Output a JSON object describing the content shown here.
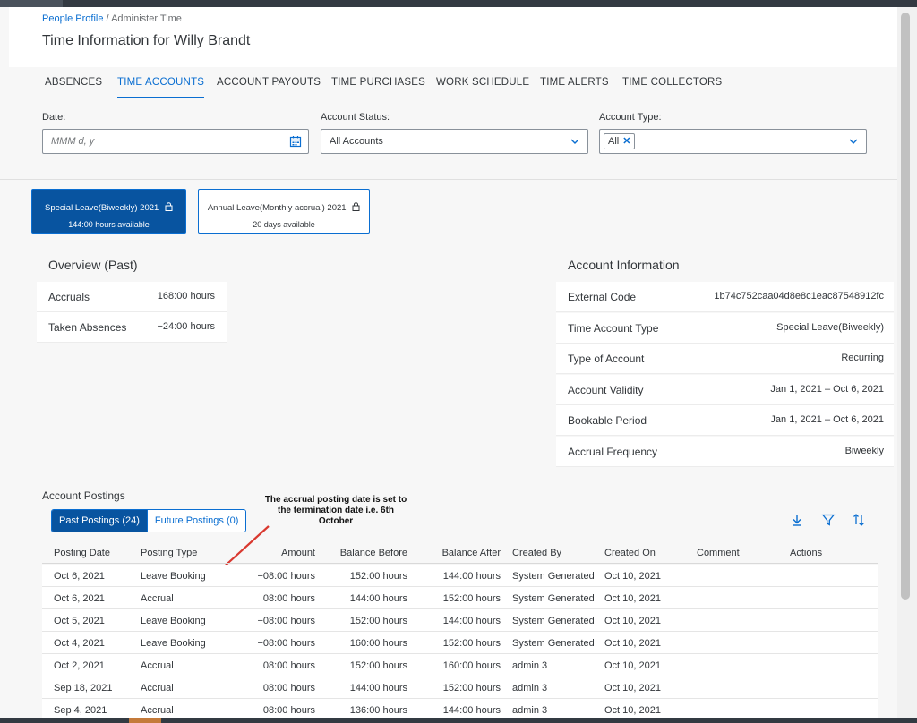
{
  "breadcrumb": {
    "link": "People Profile",
    "separator": " / ",
    "current": "Administer Time"
  },
  "title": "Time Information for Willy Brandt",
  "tabs": [
    "ABSENCES",
    "TIME ACCOUNTS",
    "ACCOUNT PAYOUTS",
    "TIME PURCHASES",
    "WORK SCHEDULE",
    "TIME ALERTS",
    "TIME COLLECTORS"
  ],
  "active_tab": "TIME ACCOUNTS",
  "filters": {
    "date": {
      "label": "Date:",
      "placeholder": "MMM d, y"
    },
    "status": {
      "label": "Account Status:",
      "value": "All Accounts"
    },
    "type": {
      "label": "Account Type:",
      "token": "All"
    }
  },
  "accounts": [
    {
      "name": "Special Leave(Biweekly) 2021",
      "available": "144:00 hours available",
      "selected": true
    },
    {
      "name": "Annual Leave(Monthly accrual) 2021",
      "available": "20 days available",
      "selected": false
    }
  ],
  "overview": {
    "title": "Overview (Past)",
    "rows": [
      {
        "label": "Accruals",
        "value": "168:00 hours"
      },
      {
        "label": "Taken Absences",
        "value": "−24:00 hours"
      }
    ]
  },
  "account_info": {
    "title": "Account Information",
    "rows": [
      {
        "label": "External Code",
        "value": "1b74c752caa04d8e8c1eac87548912fc"
      },
      {
        "label": "Time Account Type",
        "value": "Special Leave(Biweekly)"
      },
      {
        "label": "Type of Account",
        "value": "Recurring"
      },
      {
        "label": "Account Validity",
        "value": "Jan 1, 2021 – Oct 6, 2021"
      },
      {
        "label": "Bookable Period",
        "value": "Jan 1, 2021 – Oct 6, 2021"
      },
      {
        "label": "Accrual Frequency",
        "value": "Biweekly"
      }
    ]
  },
  "postings": {
    "title": "Account Postings",
    "past_label": "Past Postings (24)",
    "future_label": "Future Postings (0)",
    "annotation": "The accrual posting date is set to the termination date i.e. 6th October",
    "columns": [
      "Posting Date",
      "Posting Type",
      "Amount",
      "Balance Before",
      "Balance After",
      "Created By",
      "Created On",
      "Comment",
      "Actions"
    ],
    "rows": [
      [
        "Oct 6, 2021",
        "Leave Booking",
        "−08:00 hours",
        "152:00 hours",
        "144:00 hours",
        "System Generated",
        "Oct 10, 2021"
      ],
      [
        "Oct 6, 2021",
        "Accrual",
        "08:00 hours",
        "144:00 hours",
        "152:00 hours",
        "System Generated",
        "Oct 10, 2021"
      ],
      [
        "Oct 5, 2021",
        "Leave Booking",
        "−08:00 hours",
        "152:00 hours",
        "144:00 hours",
        "System Generated",
        "Oct 10, 2021"
      ],
      [
        "Oct 4, 2021",
        "Leave Booking",
        "−08:00 hours",
        "160:00 hours",
        "152:00 hours",
        "System Generated",
        "Oct 10, 2021"
      ],
      [
        "Oct 2, 2021",
        "Accrual",
        "08:00 hours",
        "152:00 hours",
        "160:00 hours",
        "admin 3",
        "Oct 10, 2021"
      ],
      [
        "Sep 18, 2021",
        "Accrual",
        "08:00 hours",
        "144:00 hours",
        "152:00 hours",
        "admin 3",
        "Oct 10, 2021"
      ],
      [
        "Sep 4, 2021",
        "Accrual",
        "08:00 hours",
        "136:00 hours",
        "144:00 hours",
        "admin 3",
        "Oct 10, 2021"
      ]
    ]
  },
  "icons": [
    "calendar-icon",
    "chevron-down-icon",
    "lock-icon",
    "download-icon",
    "filter-icon",
    "sort-icon"
  ],
  "colors": {
    "accent": "#0a6ed1",
    "selected": "#0854a0",
    "arrow": "#d9382f"
  }
}
